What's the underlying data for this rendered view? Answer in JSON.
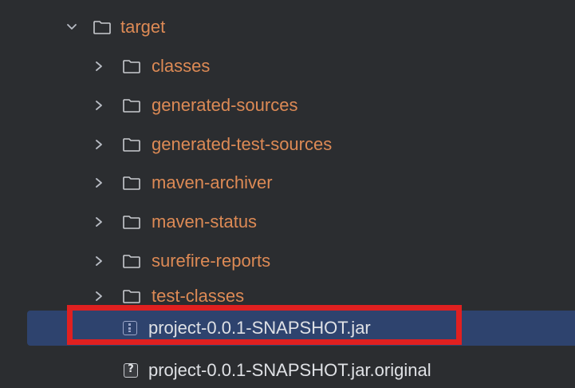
{
  "tree": {
    "root": {
      "label": "target",
      "expanded": true
    },
    "folders": [
      {
        "label": "classes"
      },
      {
        "label": "generated-sources"
      },
      {
        "label": "generated-test-sources"
      },
      {
        "label": "maven-archiver"
      },
      {
        "label": "maven-status"
      },
      {
        "label": "surefire-reports"
      },
      {
        "label": "test-classes"
      }
    ],
    "files": [
      {
        "label": "project-0.0.1-SNAPSHOT.jar",
        "icon": "jar-archive-icon",
        "selected": true
      },
      {
        "label": "project-0.0.1-SNAPSHOT.jar.original",
        "icon": "unknown-file-icon",
        "selected": false
      }
    ]
  },
  "colors": {
    "background": "#2b2d30",
    "folder_text": "#dd8a55",
    "selection": "#2e436e",
    "highlight_box": "#e02020"
  }
}
